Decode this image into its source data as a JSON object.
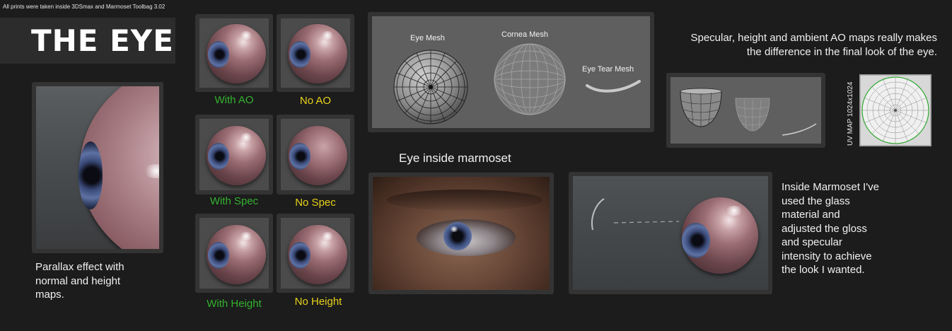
{
  "header": {
    "note": "All prints were taken inside 3DSmax and Marmoset Toolbag 3.02",
    "title": "THE EYE"
  },
  "parallax": {
    "caption": "Parallax effect with normal and height maps."
  },
  "comparisons": [
    {
      "label": "With AO",
      "color": "#33b22f"
    },
    {
      "label": "No AO",
      "color": "#e8d21a"
    },
    {
      "label": "With Spec",
      "color": "#33b22f"
    },
    {
      "label": "No Spec",
      "color": "#e8d21a"
    },
    {
      "label": "With Height",
      "color": "#33b22f"
    },
    {
      "label": "No Height",
      "color": "#e8d21a"
    }
  ],
  "meshes": {
    "eye_mesh": "Eye Mesh",
    "cornea_mesh": "Cornea Mesh",
    "tear_mesh": "Eye Tear Mesh"
  },
  "specular_text": "Specular, height and ambient AO maps really makes the difference in the final look of the eye.",
  "uv_map": "UV MAP 1024x1024",
  "marmoset_heading": "Eye inside marmoset",
  "marmoset_text": "Inside Marmoset I've used the glass material and adjusted the gloss and specular intensity to achieve the look I wanted."
}
